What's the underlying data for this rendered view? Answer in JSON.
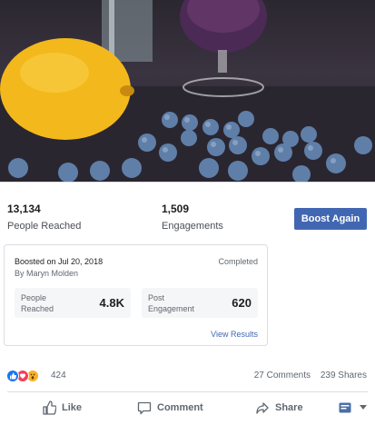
{
  "stats": {
    "people_reached_value": "13,134",
    "people_reached_label": "People Reached",
    "engagements_value": "1,509",
    "engagements_label": "Engagements",
    "boost_button": "Boost Again"
  },
  "boost_card": {
    "boosted_on": "Boosted on Jul 20, 2018",
    "boosted_by": "By Maryn Molden",
    "status": "Completed",
    "metric_reached_label": "People Reached",
    "metric_reached_value": "4.8K",
    "metric_engagement_label": "Post Engagement",
    "metric_engagement_value": "620",
    "view_results": "View Results"
  },
  "reactions": {
    "count": "424",
    "icons": [
      "like-reaction",
      "love-reaction",
      "wow-reaction"
    ],
    "comments": "27 Comments",
    "shares": "239 Shares"
  },
  "actions": {
    "like": "Like",
    "comment": "Comment",
    "share": "Share"
  },
  "colors": {
    "accent": "#4267b2",
    "like_blue": "#1877f2",
    "love_red": "#f33e58",
    "wow_yellow": "#f7b125"
  }
}
